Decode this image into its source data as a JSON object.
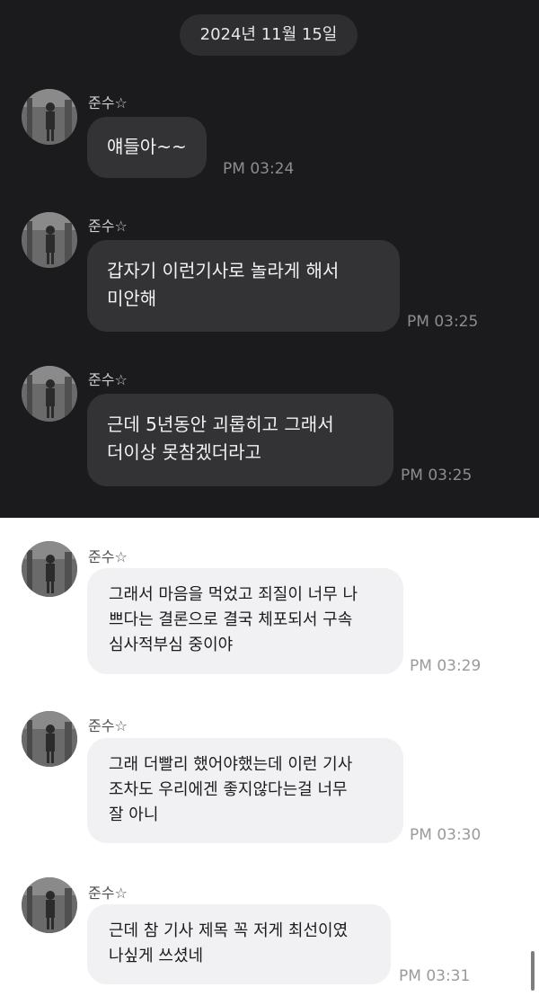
{
  "date_label": "2024년 11월 15일",
  "messages": [
    {
      "sender": "준수☆",
      "text": "얘들아~~",
      "time": "PM 03:24"
    },
    {
      "sender": "준수☆",
      "text": "갑자기 이런기사로 놀라게 해서\n미안해",
      "time": "PM 03:25"
    },
    {
      "sender": "준수☆",
      "text": "근데 5년동안 괴롭히고 그래서\n더이상 못참겠더라고",
      "time": "PM 03:25"
    },
    {
      "sender": "준수☆",
      "text": "그래서 마음을 먹었고 죄질이 너무 나\n쁘다는 결론으로 결국 체포되서 구속\n심사적부심 중이야",
      "time": "PM 03:29"
    },
    {
      "sender": "준수☆",
      "text": "그래 더빨리 했어야했는데 이런  기사\n조차도 우리에겐 좋지않다는걸 너무\n잘 아니",
      "time": "PM 03:30"
    },
    {
      "sender": "준수☆",
      "text": "근데 참 기사 제목 꼭 저게 최선이였\n나싶게 쓰셨네",
      "time": "PM 03:31"
    }
  ]
}
